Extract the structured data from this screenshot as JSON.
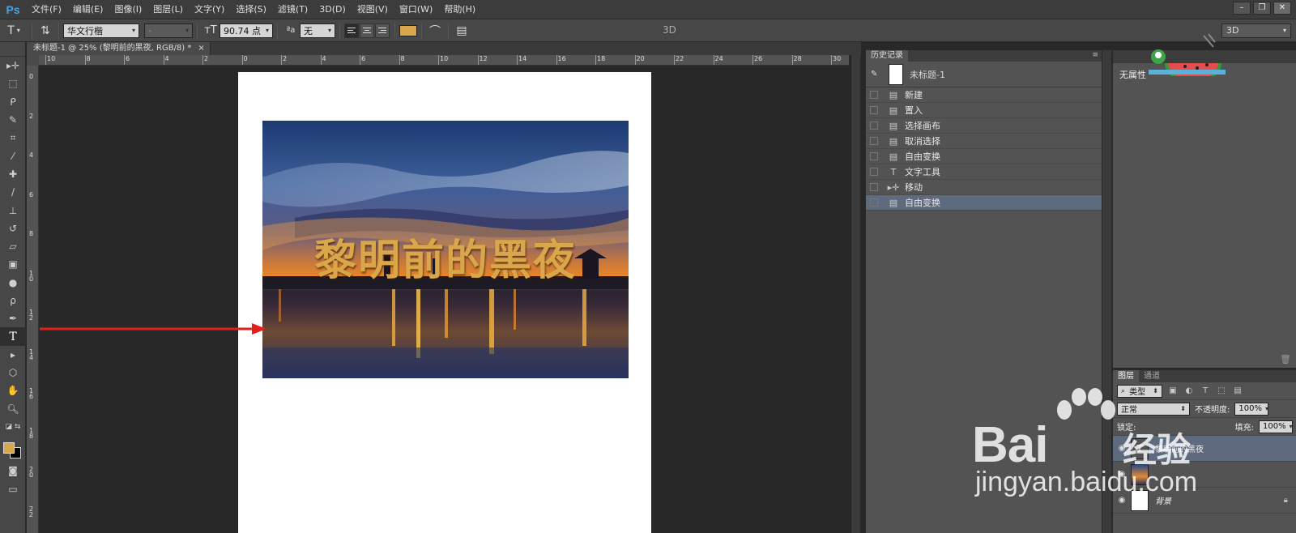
{
  "app": {
    "logo": "Ps"
  },
  "menu": [
    "文件(F)",
    "编辑(E)",
    "图像(I)",
    "图层(L)",
    "文字(Y)",
    "选择(S)",
    "滤镜(T)",
    "3D(D)",
    "视图(V)",
    "窗口(W)",
    "帮助(H)"
  ],
  "options": {
    "font_family": "华文行楷",
    "font_style": "-",
    "font_size": "90.74 点",
    "antialias_label": "ªa",
    "antialias": "无",
    "text_color": "#d9a74a",
    "mode_label": "3D",
    "workspace": "3D"
  },
  "document": {
    "tab_title": "未标题-1 @ 25% (黎明前的黑夜, RGB/8) *",
    "tab_close": "×",
    "overlay_text": "黎明前的黑夜"
  },
  "ruler": {
    "h_labels": [
      "10",
      "8",
      "6",
      "4",
      "2",
      "0",
      "2",
      "4",
      "6",
      "8",
      "10",
      "12",
      "14",
      "16",
      "18",
      "20",
      "22",
      "24",
      "26",
      "28",
      "30"
    ],
    "v_labels": [
      "0",
      "2",
      "4",
      "6",
      "8",
      "1 0",
      "1 2",
      "1 4",
      "1 6",
      "1 8",
      "2 0",
      "2 2"
    ]
  },
  "history": {
    "tab": "历史记录",
    "snapshot": "未标题-1",
    "items": [
      {
        "label": "新建",
        "icon": "doc-icon"
      },
      {
        "label": "置入",
        "icon": "doc-icon"
      },
      {
        "label": "选择画布",
        "icon": "doc-icon"
      },
      {
        "label": "取消选择",
        "icon": "doc-icon"
      },
      {
        "label": "自由变换",
        "icon": "doc-icon"
      },
      {
        "label": "文字工具",
        "icon": "type-icon"
      },
      {
        "label": "移动",
        "icon": "move-icon"
      },
      {
        "label": "自由变换",
        "icon": "doc-icon",
        "active": true
      }
    ]
  },
  "properties": {
    "label": "无属性"
  },
  "layers": {
    "tabs": [
      "图层",
      "通道"
    ],
    "filter_type": "类型",
    "blend_mode": "正常",
    "opacity_label": "不透明度:",
    "opacity": "100%",
    "lock_label": "锁定:",
    "fill_label": "填充:",
    "fill": "100%",
    "items": [
      {
        "name": "黎明前的黑夜",
        "kind": "text"
      },
      {
        "name": "",
        "kind": "image"
      },
      {
        "name": "背景",
        "kind": "background"
      }
    ]
  },
  "watermark": {
    "brand": "Bai",
    "brand_cn": "经验",
    "url": "jingyan.baidu.com"
  }
}
